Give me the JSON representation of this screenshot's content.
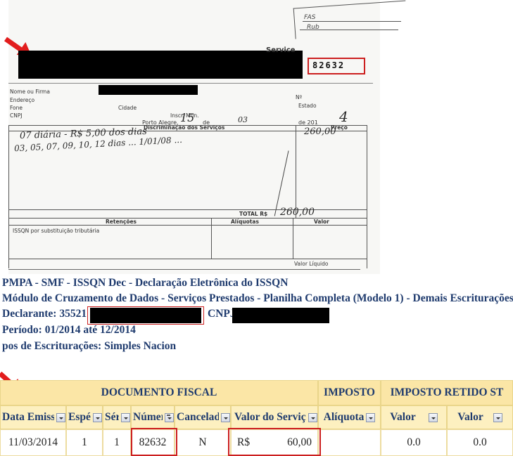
{
  "scan": {
    "invoice_number": "82632",
    "header_title_fragment": "Service",
    "stamp_lines": [
      "FAS",
      "Rub"
    ],
    "fields": {
      "name": "Nome ou Firma",
      "address": "Endereço",
      "phone": "Fone",
      "cnpj": "CNPJ",
      "number": "Nº",
      "state": "Estado",
      "city": "Cidade",
      "municipal_reg": "Inscr. Mun.",
      "place": "Porto Alegre,",
      "day_connector": "de",
      "year": "de 201"
    },
    "services_table": {
      "description_header": "Discriminação dos Serviços",
      "price_header": "Preço",
      "total_label": "TOTAL R$",
      "retention_header": "Retenções",
      "rate_header": "Alíquotas",
      "value_header": "Valor",
      "retention_line": "ISSQN por substituição tributária",
      "net_value_label": "Valor Líquido"
    },
    "handwriting": {
      "date_day": "15",
      "date_month": "03",
      "year_digit": "4",
      "line1": "07 diária - R$ 5,00 dos dias",
      "line2": "03, 05, 07, 09, 10, 12 dias ... 1/01/08 ...",
      "price": "260,00",
      "total": "260,00"
    }
  },
  "report": {
    "line1": "PMPA - SMF - ISSQN Dec - Declaração Eletrônica do ISSQN",
    "line2": "Módulo de Cruzamento de Dados - Serviços Prestados - Planilha Completa (Modelo 1) - Demais Escriturações",
    "declarant_label": "Declarante: 35521",
    "cnpj_label": "CNPJ:",
    "period": "Período: 01/2014 até 12/2014",
    "types": "pos de Escriturações:  Simples Nacion"
  },
  "grid": {
    "groups": [
      "DOCUMENTO FISCAL",
      "IMPOSTO",
      "IMPOSTO RETIDO ST"
    ],
    "columns": [
      "Data Emissã",
      "Espéc",
      "Séri",
      "Númer",
      "Cancelada",
      "Valor do Serviço",
      "Alíquota",
      "Valor",
      "Valor"
    ],
    "row": {
      "date": "11/03/2014",
      "species": "1",
      "series": "1",
      "number": "82632",
      "cancelled": "N",
      "currency": "R$",
      "amount": "60,00",
      "rate": "",
      "retained_value_1": "0.0",
      "retained_value_2": "0.0"
    }
  },
  "colors": {
    "highlight": "#cc1f1f",
    "arrow": "#e21d1d",
    "report_text": "#1f3b6e",
    "table_bg": "#fdf3cf"
  }
}
